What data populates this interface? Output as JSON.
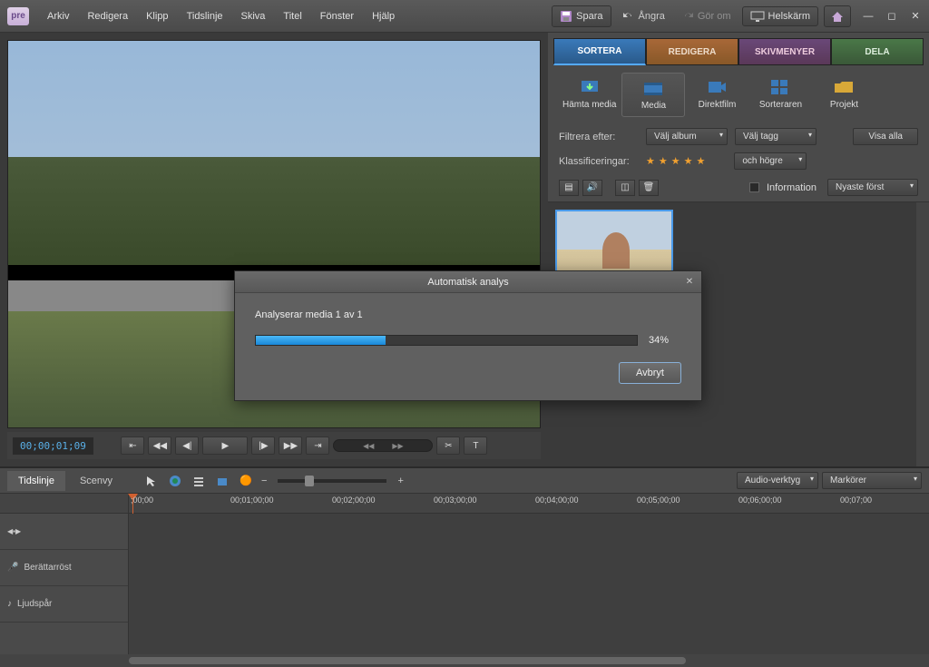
{
  "app": {
    "logo": "pre"
  },
  "menu": {
    "items": [
      "Arkiv",
      "Redigera",
      "Klipp",
      "Tidslinje",
      "Skiva",
      "Titel",
      "Fönster",
      "Hjälp"
    ]
  },
  "topbar": {
    "save": "Spara",
    "undo": "Ångra",
    "redo": "Gör om",
    "fullscreen": "Helskärm"
  },
  "workspace_tabs": {
    "sortera": "SORTERA",
    "redigera": "REDIGERA",
    "skivmenyer": "SKIVMENYER",
    "dela": "DELA"
  },
  "modules": {
    "hamta": "Hämta media",
    "media": "Media",
    "direktfilm": "Direktfilm",
    "sorteraren": "Sorteraren",
    "projekt": "Projekt"
  },
  "filters": {
    "filter_label": "Filtrera efter:",
    "album": "Välj album",
    "tag": "Välj tagg",
    "show_all": "Visa alla",
    "ratings_label": "Klassificeringar:",
    "and_higher": "och högre",
    "info_label": "Information",
    "sort": "Nyaste först"
  },
  "transport": {
    "timecode": "00;00;01;09"
  },
  "timeline": {
    "tab_timeline": "Tidslinje",
    "tab_scene": "Scenvy",
    "audio_tools": "Audio-verktyg",
    "markers": "Markörer",
    "ticks": [
      ";00;00",
      "00;01;00;00",
      "00;02;00;00",
      "00;03;00;00",
      "00;04;00;00",
      "00;05;00;00",
      "00;06;00;00",
      "00;07;00"
    ],
    "track_narration": "Berättarröst",
    "track_audio": "Ljudspår"
  },
  "dialog": {
    "title": "Automatisk analys",
    "message": "Analyserar media 1 av 1",
    "percent": "34%",
    "percent_val": 34,
    "cancel": "Avbryt"
  }
}
